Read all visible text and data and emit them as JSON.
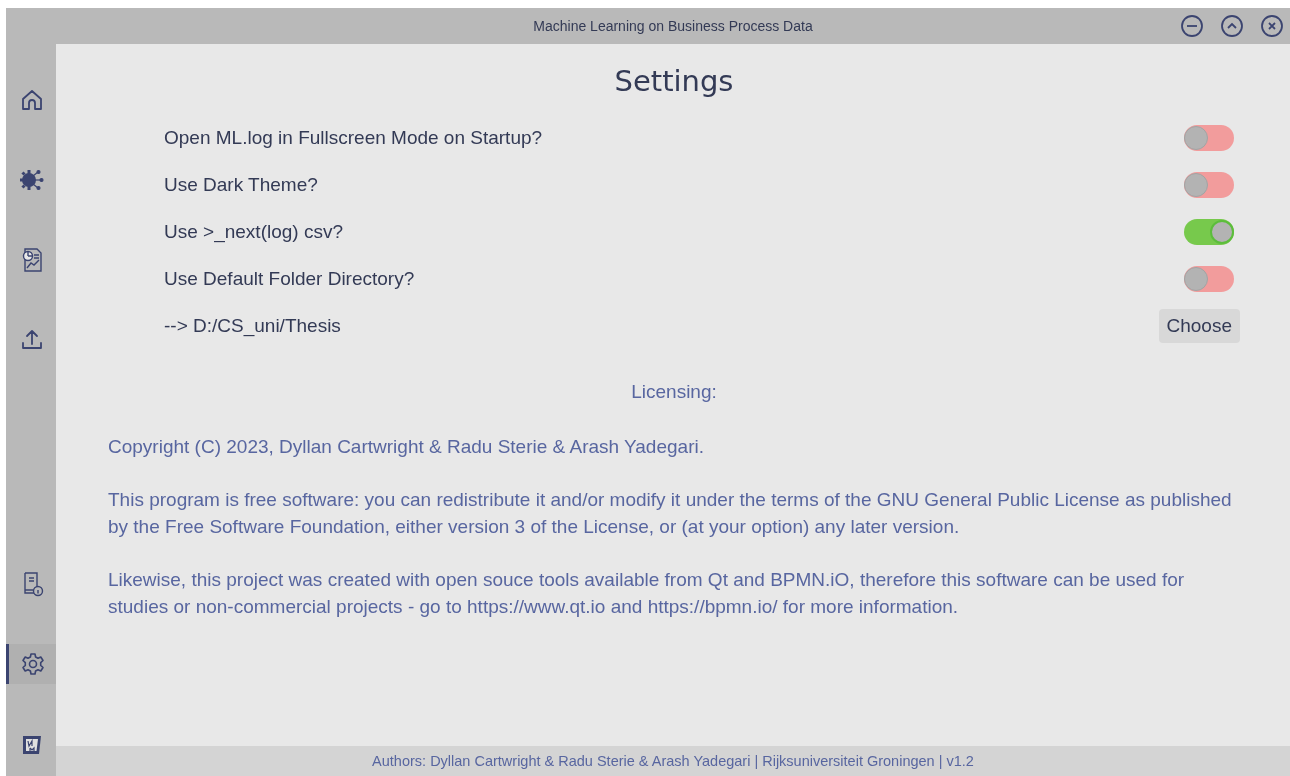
{
  "window": {
    "title": "Machine Learning on Business Process Data"
  },
  "sidebar": {
    "top_items": [
      {
        "selected": false
      },
      {
        "selected": false
      },
      {
        "selected": false
      },
      {
        "selected": false
      }
    ],
    "bottom_items": [
      {
        "selected": false
      },
      {
        "selected": true
      },
      {
        "selected": false
      }
    ]
  },
  "settings": {
    "title": "Settings",
    "toggles": [
      {
        "label": "Open ML.log in Fullscreen Mode on Startup?",
        "on": false
      },
      {
        "label": "Use Dark Theme?",
        "on": false
      },
      {
        "label": "Use >_next(log) csv?",
        "on": true
      },
      {
        "label": "Use Default Folder Directory?",
        "on": false
      }
    ],
    "folder": {
      "path": "--> D:/CS_uni/Thesis",
      "button": "Choose"
    }
  },
  "licensing": {
    "heading": "Licensing:",
    "paragraphs": [
      "Copyright (C) 2023, Dyllan Cartwright & Radu Sterie & Arash Yadegari.",
      "This program is free software: you can redistribute it and/or modify it under the terms of the GNU General Public License as published by the Free Software Foundation, either version 3 of the License, or (at your option) any later version.",
      "Likewise, this project was created with open souce tools available from Qt and BPMN.iO, therefore this software can be used for studies or non-commercial projects - go to https://www.qt.io and https://bpmn.io/ for more information."
    ]
  },
  "status_bar": "Authors: Dyllan Cartwright & Radu Sterie & Arash Yadegari | Rijksuniversiteit Groningen | v1.2"
}
